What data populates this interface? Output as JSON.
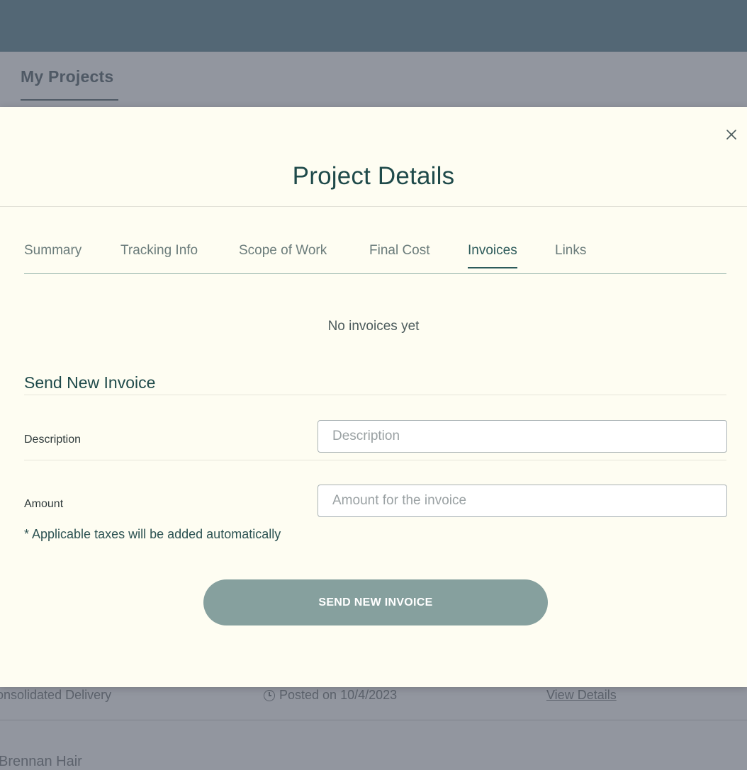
{
  "background": {
    "page_heading": "My Projects",
    "row": {
      "name": "onsolidated Delivery",
      "posted": "Posted on 10/4/2023",
      "link": "View Details"
    },
    "next_row_name": "Brennan Hair"
  },
  "modal": {
    "title": "Project Details",
    "close_icon": "close-icon",
    "tabs": [
      {
        "label": "Summary"
      },
      {
        "label": "Tracking Info"
      },
      {
        "label": "Scope of Work"
      },
      {
        "label": "Final Cost"
      },
      {
        "label": "Invoices",
        "active": true
      },
      {
        "label": "Links"
      }
    ],
    "empty_state": "No invoices yet",
    "form": {
      "section_title": "Send New Invoice",
      "description_label": "Description",
      "description_placeholder": "Description",
      "description_value": "",
      "amount_label": "Amount",
      "amount_placeholder": "Amount for the invoice",
      "amount_value": "",
      "tax_note": "* Applicable taxes will be added automatically",
      "submit_label": "SEND NEW INVOICE"
    }
  },
  "colors": {
    "topbar": "#536775",
    "modal_bg": "#fefdf2",
    "accent": "#2c5a5a",
    "button": "#86a09e"
  }
}
